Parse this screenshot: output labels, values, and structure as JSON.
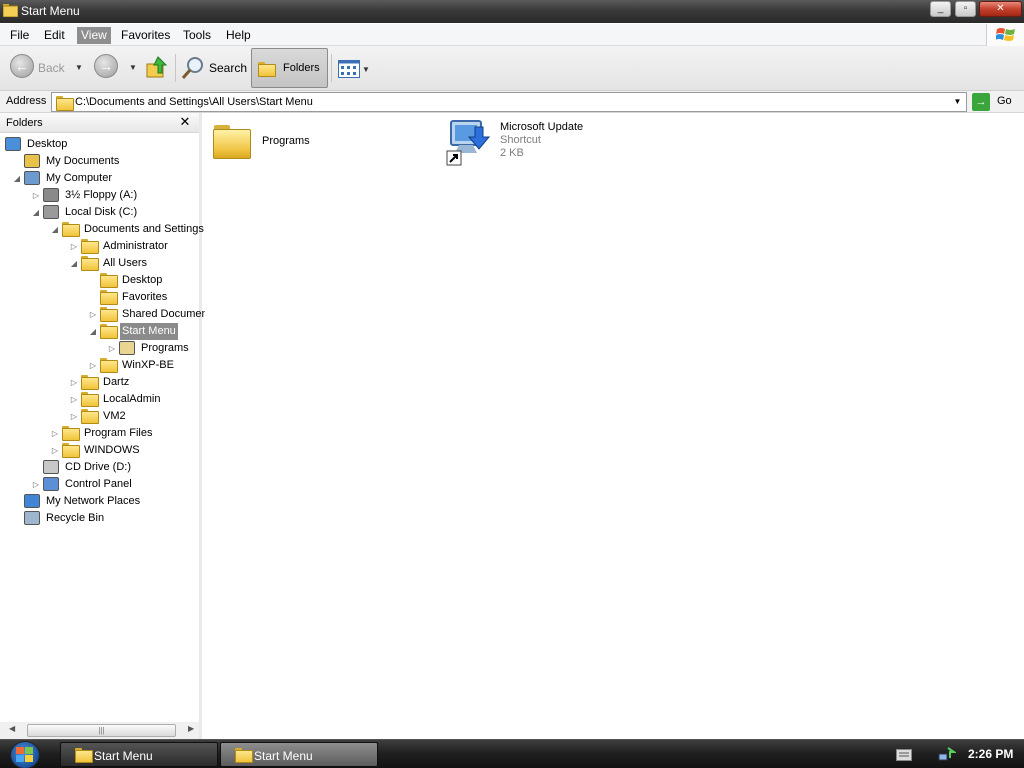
{
  "window": {
    "title": "Start Menu",
    "controls": [
      "minimize",
      "maximize",
      "close"
    ]
  },
  "menubar": {
    "items": [
      "File",
      "Edit",
      "View",
      "Favorites",
      "Tools",
      "Help"
    ],
    "active": "View"
  },
  "toolbar": {
    "back_label": "Back",
    "search_label": "Search",
    "folders_label": "Folders"
  },
  "address": {
    "label": "Address",
    "value": "C:\\Documents and Settings\\All Users\\Start Menu",
    "go_label": "Go"
  },
  "folders_pane": {
    "title": "Folders",
    "tree": [
      {
        "label": "Desktop",
        "depth": 0,
        "expander": "",
        "icon": "desktop-icon"
      },
      {
        "label": "My Documents",
        "depth": 1,
        "expander": "",
        "icon": "documents-icon"
      },
      {
        "label": "My Computer",
        "depth": 1,
        "expander": "◢",
        "icon": "computer-icon"
      },
      {
        "label": "3½ Floppy (A:)",
        "depth": 2,
        "expander": "▷",
        "icon": "floppy-icon"
      },
      {
        "label": "Local Disk (C:)",
        "depth": 2,
        "expander": "◢",
        "icon": "disk-icon"
      },
      {
        "label": "Documents and Settings",
        "depth": 3,
        "expander": "◢",
        "icon": "folder-icon"
      },
      {
        "label": "Administrator",
        "depth": 4,
        "expander": "▷",
        "icon": "folder-icon"
      },
      {
        "label": "All Users",
        "depth": 4,
        "expander": "◢",
        "icon": "folder-icon"
      },
      {
        "label": "Desktop",
        "depth": 5,
        "expander": "",
        "icon": "folder-icon"
      },
      {
        "label": "Favorites",
        "depth": 5,
        "expander": "",
        "icon": "folder-icon"
      },
      {
        "label": "Shared Document",
        "depth": 5,
        "expander": "▷",
        "icon": "folder-icon"
      },
      {
        "label": "Start Menu",
        "depth": 5,
        "expander": "◢",
        "icon": "folder-icon",
        "selected": true
      },
      {
        "label": "Programs",
        "depth": 6,
        "expander": "▷",
        "icon": "programs-folder-icon"
      },
      {
        "label": "WinXP-BE",
        "depth": 5,
        "expander": "▷",
        "icon": "folder-icon"
      },
      {
        "label": "Dartz",
        "depth": 4,
        "expander": "▷",
        "icon": "folder-icon"
      },
      {
        "label": "LocalAdmin",
        "depth": 4,
        "expander": "▷",
        "icon": "folder-icon"
      },
      {
        "label": "VM2",
        "depth": 4,
        "expander": "▷",
        "icon": "folder-icon"
      },
      {
        "label": "Program Files",
        "depth": 3,
        "expander": "▷",
        "icon": "folder-icon"
      },
      {
        "label": "WINDOWS",
        "depth": 3,
        "expander": "▷",
        "icon": "folder-icon"
      },
      {
        "label": "CD Drive (D:)",
        "depth": 2,
        "expander": "",
        "icon": "cd-icon"
      },
      {
        "label": "Control Panel",
        "depth": 2,
        "expander": "▷",
        "icon": "control-panel-icon"
      },
      {
        "label": "My Network Places",
        "depth": 1,
        "expander": "",
        "icon": "network-icon"
      },
      {
        "label": "Recycle Bin",
        "depth": 1,
        "expander": "",
        "icon": "recycle-bin-icon"
      }
    ],
    "scroll_thumb_grip": "|||"
  },
  "content": {
    "items": [
      {
        "name": "Programs",
        "type": "folder"
      },
      {
        "name": "Microsoft Update",
        "sub1": "Shortcut",
        "sub2": "2 KB",
        "type": "shortcut"
      }
    ]
  },
  "taskbar": {
    "buttons": [
      {
        "label": "Start Menu",
        "active": false
      },
      {
        "label": "Start Menu",
        "active": true
      }
    ],
    "clock": "2:26 PM"
  },
  "colors": {
    "selection": "#8b8b8b",
    "titlebar": "#3a3a3a",
    "folder": "#f0c43a"
  }
}
